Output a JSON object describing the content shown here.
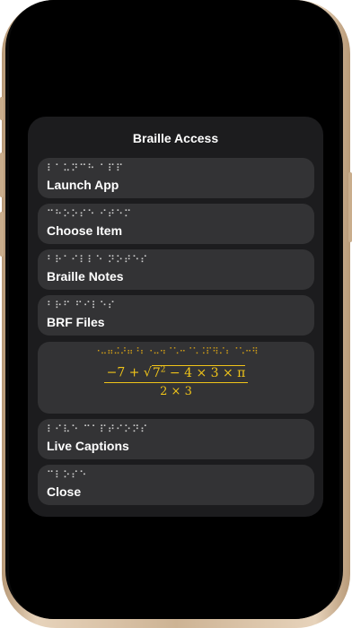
{
  "panel": {
    "title": "Braille Access"
  },
  "items": [
    {
      "braille": "⠇⠁⠥⠝⠉⠓ ⠁⠏⠏",
      "label": "Launch App"
    },
    {
      "braille": "⠉⠓⠕⠕⠎⠑ ⠊⠞⠑⠍",
      "label": "Choose Item"
    },
    {
      "braille": "⠃⠗⠁⠊⠇⠇⠑ ⠝⠕⠞⠑⠎",
      "label": "Braille Notes"
    },
    {
      "braille": "⠃⠗⠋ ⠋⠊⠇⠑⠎",
      "label": "BRF Files"
    }
  ],
  "math": {
    "braille": "⠐⠤⠶⠬⠜⠶⠘⠆⠐⠤⠲⠈⠡⠒⠈⠡⠨⠏⠻⠌⠆⠈⠡⠒⠻",
    "num_prefix": "−7 + ",
    "sqrt_symbol": "√",
    "radicand_base": "7",
    "radicand_exp": "2",
    "radicand_rest": " − 4 × 3 × π",
    "denominator": "2 × 3"
  },
  "items_bottom": [
    {
      "braille": "⠇⠊⠧⠑ ⠉⠁⠏⠞⠊⠕⠝⠎",
      "label": "Live Captions"
    },
    {
      "braille": "⠉⠇⠕⠎⠑",
      "label": "Close"
    }
  ],
  "colors": {
    "panel_bg": "#1c1c1e",
    "row_bg": "#333335",
    "math_accent": "#f0c419",
    "phone_frame": "#cdb394"
  }
}
